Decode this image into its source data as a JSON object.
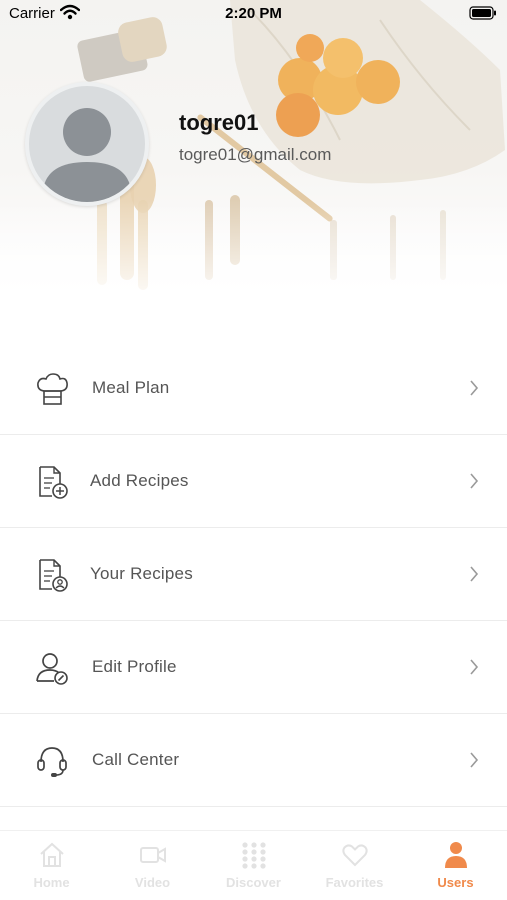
{
  "status_bar": {
    "carrier": "Carrier",
    "time": "2:20 PM"
  },
  "profile": {
    "username": "togre01",
    "email": "togre01@gmail.com"
  },
  "menu": [
    {
      "label": "Meal Plan",
      "icon": "chef-hat-icon"
    },
    {
      "label": "Add Recipes",
      "icon": "document-add-icon"
    },
    {
      "label": "Your Recipes",
      "icon": "document-user-icon"
    },
    {
      "label": "Edit Profile",
      "icon": "user-edit-icon"
    },
    {
      "label": "Call Center",
      "icon": "headset-icon"
    }
  ],
  "tab_bar": {
    "tabs": [
      {
        "label": "Home",
        "icon": "home-icon",
        "active": false
      },
      {
        "label": "Video",
        "icon": "video-icon",
        "active": false
      },
      {
        "label": "Discover",
        "icon": "grid-dots-icon",
        "active": false
      },
      {
        "label": "Favorites",
        "icon": "heart-icon",
        "active": false
      },
      {
        "label": "Users",
        "icon": "user-icon",
        "active": true
      }
    ]
  },
  "colors": {
    "accent": "#f08a4b",
    "inactive_tab": "#e2e2e2",
    "text": "#555555"
  }
}
